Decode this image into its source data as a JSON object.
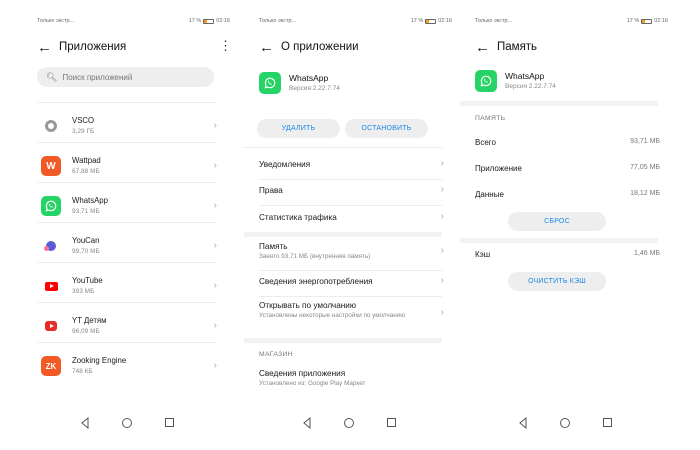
{
  "status": {
    "carrier": "Только экстр...",
    "battery": "17 %",
    "time": "02:16"
  },
  "screen1": {
    "title": "Приложения",
    "search_placeholder": "Поиск приложений",
    "apps": [
      {
        "name": "VSCO",
        "size": "3,29 ГБ",
        "icon": "vsco-icon"
      },
      {
        "name": "Wattpad",
        "size": "67,88 МБ",
        "icon": "wattpad-icon"
      },
      {
        "name": "WhatsApp",
        "size": "93,71 МБ",
        "icon": "whatsapp-icon"
      },
      {
        "name": "YouCan",
        "size": "99,70 МБ",
        "icon": "youcan-icon"
      },
      {
        "name": "YouTube",
        "size": "393 МБ",
        "icon": "youtube-icon"
      },
      {
        "name": "YT Детям",
        "size": "96,09 МБ",
        "icon": "yt-kids-icon"
      },
      {
        "name": "Zooking Engine",
        "size": "748 КБ",
        "icon": "zooking-engine-icon"
      }
    ]
  },
  "screen2": {
    "title": "О приложении",
    "app_name": "WhatsApp",
    "app_version": "Версия 2.22.7.74",
    "delete_label": "УДАЛИТЬ",
    "stop_label": "ОСТАНОВИТЬ",
    "items": {
      "notifications": "Уведомления",
      "permissions": "Права",
      "traffic": "Статистика трафика",
      "memory": "Память",
      "memory_sub": "Занято 93,71 МБ (внутренняя память)",
      "energy": "Сведения энергопотребления",
      "open_default": "Открывать по умолчанию",
      "open_default_sub": "Установлены некоторые настройки по умолчанию",
      "store_caption": "МАГАЗИН",
      "app_details": "Сведения приложения",
      "app_details_sub": "Установлено из: Google Play Маркет"
    }
  },
  "screen3": {
    "title": "Память",
    "app_name": "WhatsApp",
    "app_version": "Версия 2.22.7.74",
    "memory_caption": "ПАМЯТЬ",
    "total_label": "Всего",
    "total_value": "93,71 МБ",
    "app_label": "Приложение",
    "app_value": "77,05 МБ",
    "data_label": "Данные",
    "data_value": "18,12 МБ",
    "reset_label": "СБРОС",
    "cache_label": "Кэш",
    "cache_value": "1,46 МБ",
    "clear_cache_label": "ОЧИСТИТЬ КЭШ"
  },
  "colors": {
    "accent": "#1e88e5",
    "whatsapp": "#25d366",
    "wattpad": "#f15a24",
    "youtube": "#ff0000"
  }
}
